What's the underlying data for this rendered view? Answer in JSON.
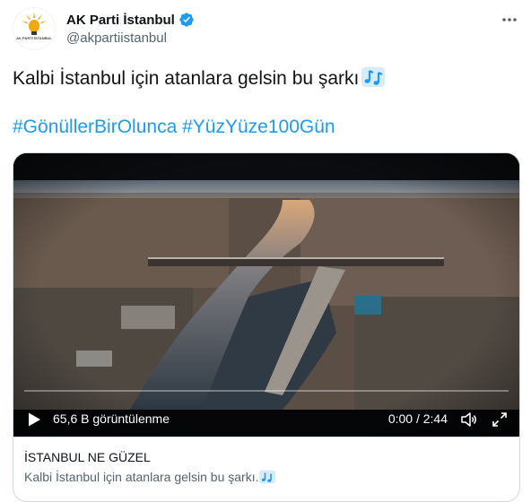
{
  "tweet": {
    "author": {
      "display_name": "AK Parti İstanbul",
      "handle": "@akpartiistanbul",
      "verified": true,
      "avatar_caption": "AK PARTİ İSTANBUL"
    },
    "text": "Kalbi İstanbul için atanlara gelsin bu şarkı",
    "text_emoji": "musical-notes-icon",
    "hashtags": [
      "#GönüllerBirOlunca",
      "#YüzYüze100Gün"
    ],
    "media": {
      "views": "65,6 B görüntülenme",
      "time": "0:00 / 2:44",
      "progress": 0
    },
    "card": {
      "title": "İSTANBUL NE GÜZEL",
      "description": "Kalbi İstanbul için atanlara gelsin bu şarkı."
    }
  },
  "colors": {
    "link": "#1d9bf0",
    "verified": "#1d9bf0",
    "text": "#0f1419",
    "muted": "#536471",
    "border": "#cfd9de"
  }
}
